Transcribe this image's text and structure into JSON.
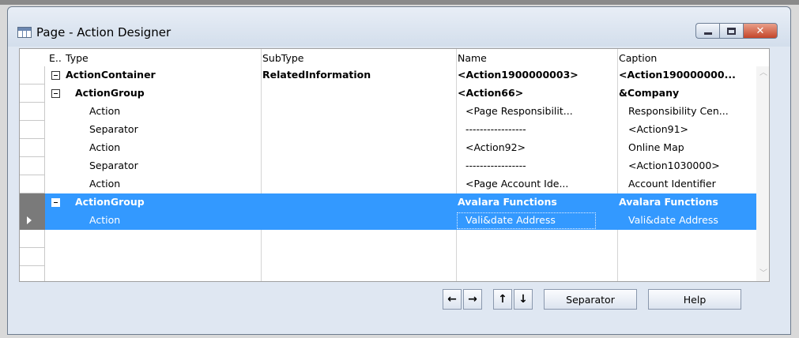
{
  "window": {
    "title": "Page - Action Designer"
  },
  "columns": [
    "E..",
    "Type",
    "SubType",
    "Name",
    "Caption"
  ],
  "rows": [
    {
      "type": "ActionContainer",
      "subtype": "RelatedInformation",
      "name": "<Action1900000003>",
      "caption": "<Action190000000...",
      "toggle": true,
      "bold": true,
      "indent": 0
    },
    {
      "type": "ActionGroup",
      "subtype": "",
      "name": "<Action66>",
      "caption": "&Company",
      "toggle": true,
      "bold": true,
      "indent": 1
    },
    {
      "type": "Action",
      "subtype": "",
      "name": "<Page Responsibilit...",
      "caption": "Responsibility Cen...",
      "toggle": false,
      "bold": false,
      "indent": 2
    },
    {
      "type": "Separator",
      "subtype": "",
      "name": "-----------------",
      "caption": "<Action91>",
      "toggle": false,
      "bold": false,
      "indent": 2
    },
    {
      "type": "Action",
      "subtype": "",
      "name": "<Action92>",
      "caption": "Online Map",
      "toggle": false,
      "bold": false,
      "indent": 2
    },
    {
      "type": "Separator",
      "subtype": "",
      "name": "-----------------",
      "caption": "<Action1030000>",
      "toggle": false,
      "bold": false,
      "indent": 2
    },
    {
      "type": "Action",
      "subtype": "",
      "name": "<Page Account Ide...",
      "caption": "Account Identifier",
      "toggle": false,
      "bold": false,
      "indent": 2
    },
    {
      "type": "ActionGroup",
      "subtype": "",
      "name": "Avalara Functions",
      "caption": "Avalara Functions",
      "toggle": true,
      "bold": true,
      "indent": 1,
      "selected": true
    },
    {
      "type": "Action",
      "subtype": "",
      "name": "Vali&date Address",
      "caption": "Vali&date Address",
      "toggle": false,
      "bold": false,
      "indent": 2,
      "selected": true,
      "current": true
    }
  ],
  "buttons": {
    "move_left": "←",
    "move_right": "→",
    "move_up": "↑",
    "move_down": "↓",
    "separator": "Separator",
    "help": "Help"
  },
  "colors": {
    "selection": "#3399ff",
    "title_bg": "#dfe7f2",
    "close_button": "#c4452a"
  }
}
